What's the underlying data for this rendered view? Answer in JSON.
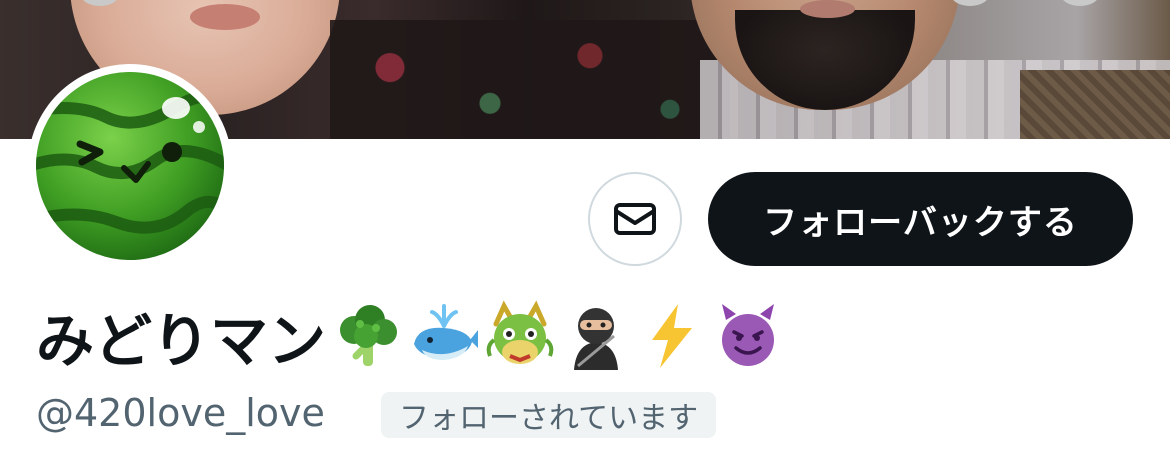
{
  "profile": {
    "display_name": "みどりマン",
    "display_name_emojis": [
      "broccoli",
      "spouting-whale",
      "dragon-face",
      "ninja",
      "high-voltage",
      "smiling-face-with-horns"
    ],
    "handle": "@420love_love",
    "follows_you_badge": "フォローされています"
  },
  "actions": {
    "message_icon": "envelope-icon",
    "follow_back_label": "フォローバックする"
  },
  "colors": {
    "follow_button_bg": "#0f1419",
    "follow_button_text": "#ffffff",
    "handle_text": "#536471",
    "badge_bg": "#eff3f4",
    "dm_border": "#cfd9de"
  }
}
